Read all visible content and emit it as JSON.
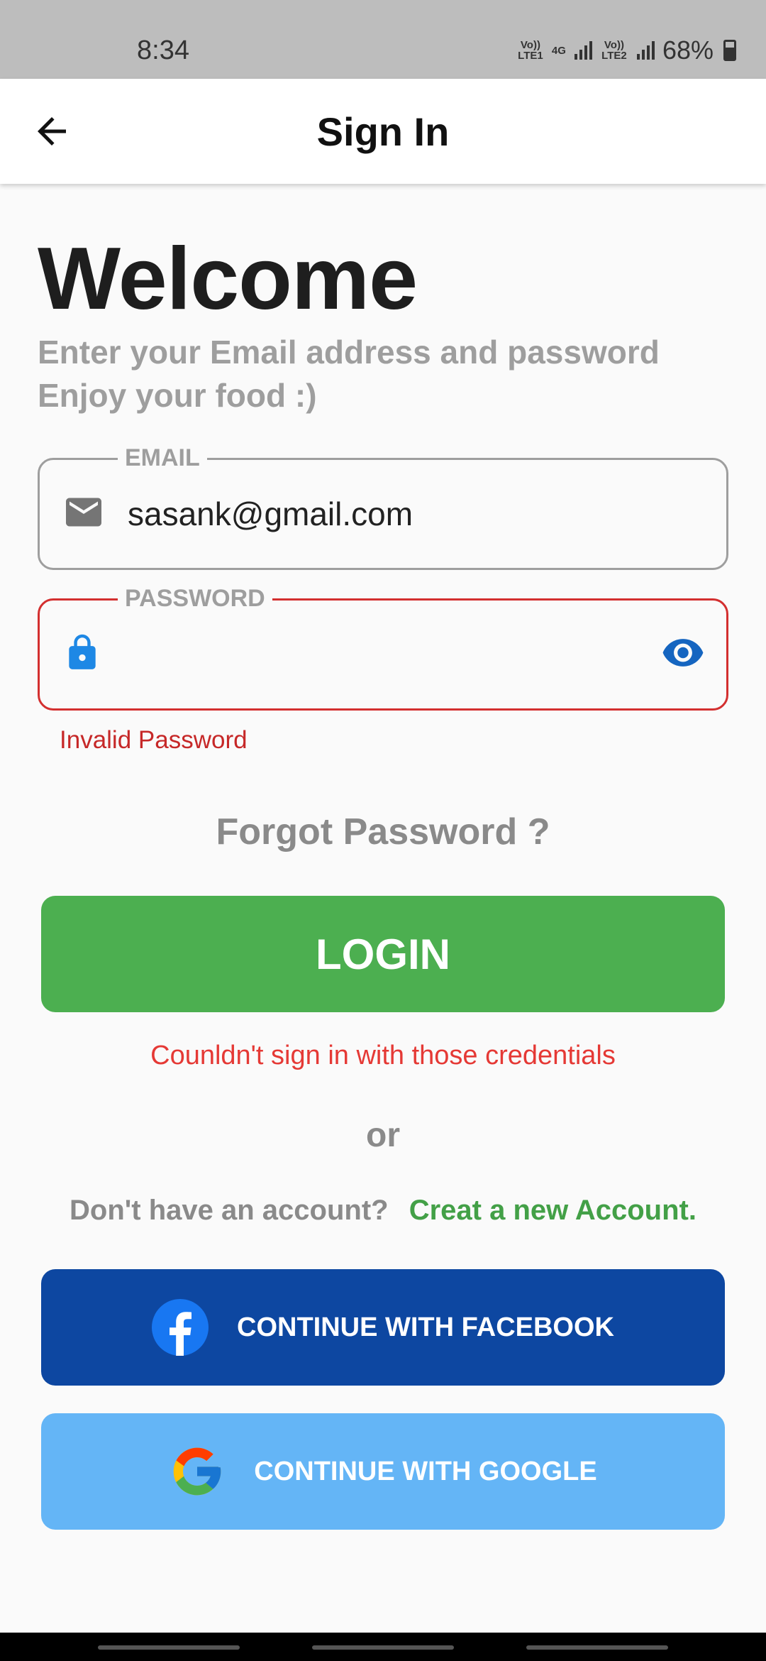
{
  "status_bar": {
    "time": "8:34",
    "net1": "Vo)) LTE1",
    "net_type": "4G",
    "net2": "Vo)) LTE2",
    "battery": "68%"
  },
  "app_bar": {
    "title": "Sign In",
    "back_icon": "arrow-left-icon"
  },
  "header": {
    "welcome": "Welcome",
    "subtitle_line1": "Enter your Email address and password",
    "subtitle_line2": "Enjoy your food :)"
  },
  "email": {
    "label": "EMAIL",
    "value": "sasank@gmail.com",
    "icon": "mail-icon"
  },
  "password": {
    "label": "PASSWORD",
    "value": "",
    "error": "Invalid Password",
    "icon": "lock-icon",
    "toggle_icon": "eye-icon"
  },
  "forgot_password": "Forgot Password ?",
  "login_button": "LOGIN",
  "login_error": "Counldn't sign in with those credentials",
  "or_text": "or",
  "signup": {
    "question": "Don't have an account?",
    "link": "Creat a new Account."
  },
  "facebook_button": "CONTINUE WITH FACEBOOK",
  "google_button": "CONTINUE WITH GOOGLE",
  "colors": {
    "primary_green": "#4caf50",
    "error_red": "#d32f2f",
    "facebook_blue": "#0d47a1",
    "google_light_blue": "#64b5f6",
    "icon_blue": "#1e88e5"
  }
}
